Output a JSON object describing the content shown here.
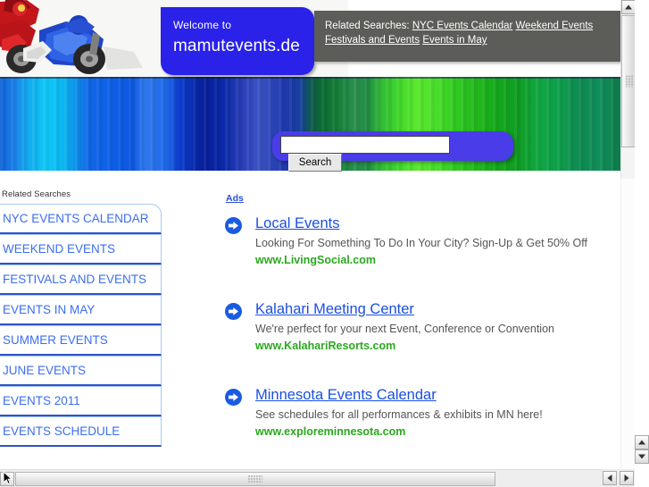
{
  "site": {
    "welcome_prefix": "Welcome to",
    "domain": "mamutevents.de"
  },
  "header": {
    "related_searches_label": "Related Searches:",
    "related_searches": [
      "NYC Events Calendar",
      "Weekend Events",
      "Festivals and Events",
      "Events in May"
    ],
    "banner_image_name": "motocross-rider-illustration"
  },
  "search": {
    "value": "",
    "placeholder": "",
    "button_label": "Search"
  },
  "rail": {
    "title": "Related Searches",
    "items": [
      {
        "label": "NYC EVENTS CALENDAR"
      },
      {
        "label": "WEEKEND EVENTS"
      },
      {
        "label": "FESTIVALS AND EVENTS"
      },
      {
        "label": "EVENTS IN MAY"
      },
      {
        "label": "SUMMER EVENTS"
      },
      {
        "label": "JUNE EVENTS"
      },
      {
        "label": "EVENTS 2011"
      },
      {
        "label": "EVENTS SCHEDULE"
      }
    ]
  },
  "ads": {
    "label": "Ads",
    "items": [
      {
        "title": "Local Events",
        "description": "Looking For Something To Do In Your City? Sign-Up & Get 50% Off",
        "url": "www.LivingSocial.com"
      },
      {
        "title": "Kalahari Meeting Center",
        "description": "We're perfect for your next Event, Conference or Convention",
        "url": "www.KalahariResorts.com"
      },
      {
        "title": "Minnesota Events Calendar",
        "description": "See schedules for all performances & exhibits in MN here!",
        "url": "www.exploreminnesota.com"
      }
    ]
  },
  "colors": {
    "welcome_plate": "#2a22e8",
    "related_plate": "#5c5c58",
    "search_pod": "#4a3ce8",
    "link_blue": "#1a4fe0",
    "url_green": "#2aa81f",
    "rail_border": "#2f52c8"
  },
  "scrollbars": {
    "banner_vertical_thumb_label": "banner-frame-vertical-thumb",
    "outer_horizontal_thumb_label": "page-horizontal-thumb"
  }
}
